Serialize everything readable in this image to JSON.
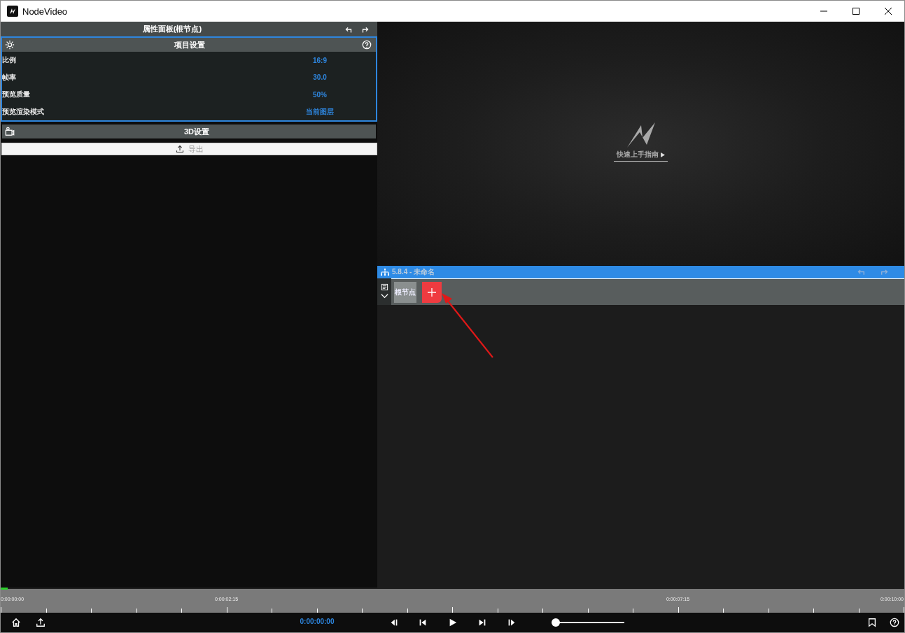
{
  "window": {
    "title": "NodeVideo"
  },
  "properties_panel": {
    "title": "属性面板(根节点)",
    "sections": [
      {
        "kind": "gear",
        "title": "项目设置",
        "expanded": true,
        "help": true,
        "rows": [
          {
            "label": "比例",
            "value": "16:9"
          },
          {
            "label": "帧率",
            "value": "30.0"
          },
          {
            "label": "预览质量",
            "value": "50%"
          },
          {
            "label": "预览渲染模式",
            "value": "当前图层"
          }
        ]
      },
      {
        "kind": "camera",
        "title": "3D设置",
        "expanded": false,
        "help": false
      }
    ],
    "export_button": "导出"
  },
  "preview": {
    "guide_link": "快速上手指南"
  },
  "node_editor": {
    "title": "5.8.4 - 未命名",
    "nodes": [
      {
        "label": "根节点"
      }
    ]
  },
  "timeline": {
    "labels": [
      "0:00:00:00",
      "0:00:02:15",
      "0:00:07:15",
      "0:00:10:00"
    ]
  },
  "playback": {
    "timecode": "0:00:00:00",
    "zoom": {
      "level": 0
    }
  }
}
